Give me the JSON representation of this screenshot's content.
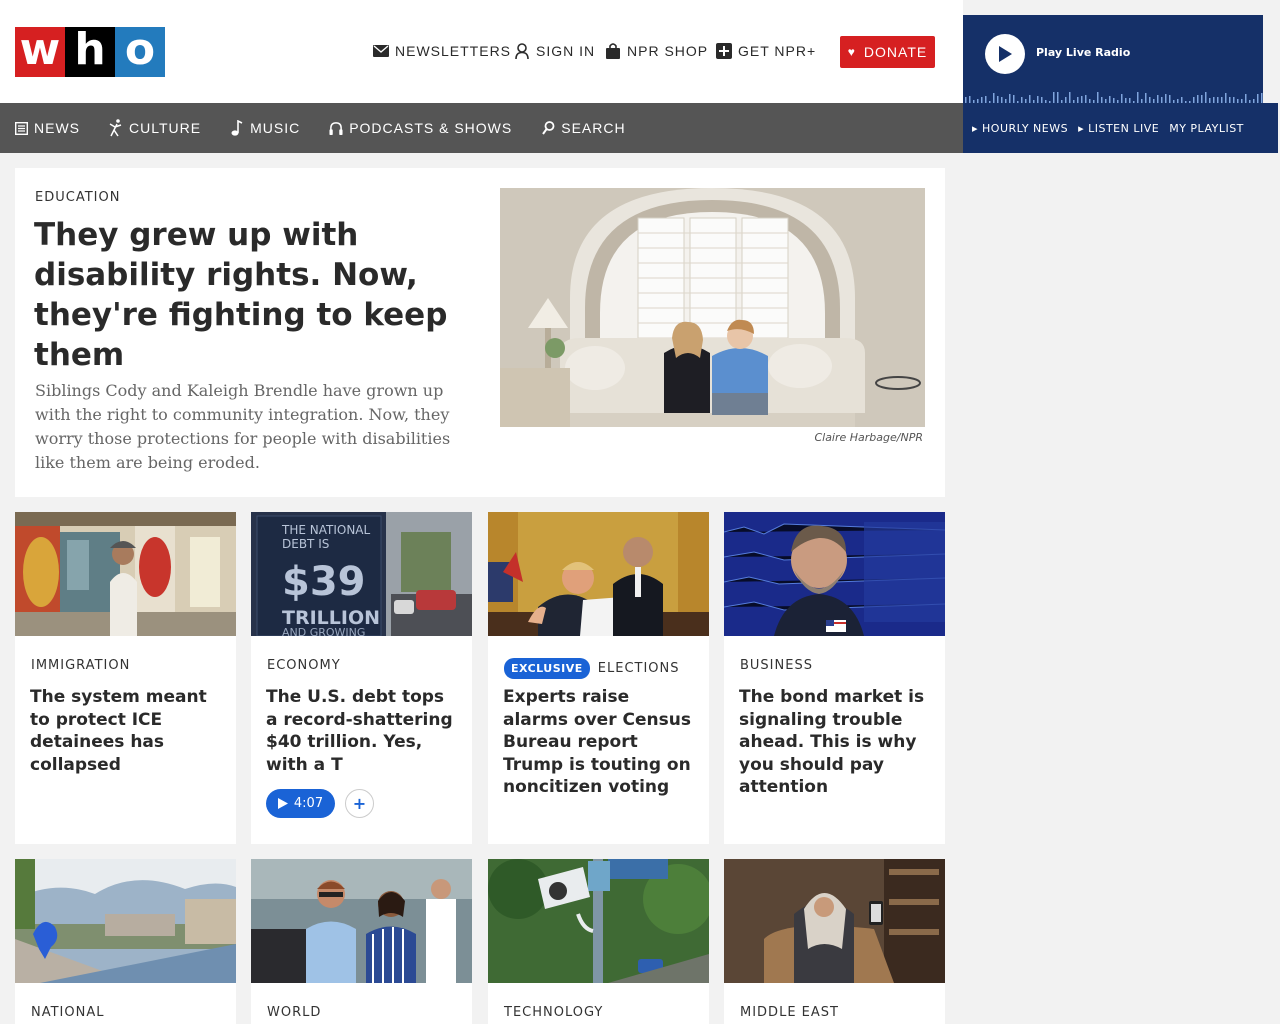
{
  "logo": {
    "letters": [
      "w",
      "h",
      "o"
    ]
  },
  "utility": {
    "newsletters": "NEWSLETTERS",
    "sign_in": "SIGN IN",
    "shop": "NPR SHOP",
    "get_plus": "GET NPR+",
    "donate": "DONATE"
  },
  "player": {
    "play_label": "Play Live Radio",
    "hourly_news": "HOURLY NEWS",
    "listen_live": "LISTEN LIVE",
    "my_playlist": "MY PLAYLIST"
  },
  "nav": {
    "items": [
      {
        "label": "NEWS",
        "icon": "news-icon"
      },
      {
        "label": "CULTURE",
        "icon": "culture-icon"
      },
      {
        "label": "MUSIC",
        "icon": "music-icon"
      },
      {
        "label": "PODCASTS & SHOWS",
        "icon": "headphones-icon"
      },
      {
        "label": "SEARCH",
        "icon": "search-icon"
      }
    ]
  },
  "hero": {
    "kicker": "EDUCATION",
    "title": "They grew up with disability rights. Now, they're fighting to keep them",
    "teaser": "Siblings Cody and Kaleigh Brendle have grown up with the right to community integration. Now, they worry those protections for people with disabilities like them are being eroded.",
    "credit": "Claire Harbage/NPR"
  },
  "cards": [
    {
      "slug": "IMMIGRATION",
      "title": "The system meant to protect ICE detainees has collapsed"
    },
    {
      "slug": "ECONOMY",
      "title": "The U.S. debt tops a record-shattering $40 trillion. Yes, with a T",
      "audio_duration": "4:07",
      "image_text": [
        "THE NATIONAL",
        "DEBT IS",
        "$39",
        "TRILLION",
        "AND GROWING"
      ]
    },
    {
      "slug": "ELECTIONS",
      "badge": "EXCLUSIVE",
      "title": "Experts raise alarms over Census Bureau report Trump is touting on noncitizen voting"
    },
    {
      "slug": "BUSINESS",
      "title": "The bond market is signaling trouble ahead. This is why you should pay attention"
    },
    {
      "slug": "NATIONAL"
    },
    {
      "slug": "WORLD"
    },
    {
      "slug": "TECHNOLOGY"
    },
    {
      "slug": "MIDDLE EAST"
    }
  ],
  "colors": {
    "brand_red": "#d62021",
    "player_blue": "#153068",
    "nav_gray": "#555555",
    "accent_blue": "#1a63d6"
  }
}
